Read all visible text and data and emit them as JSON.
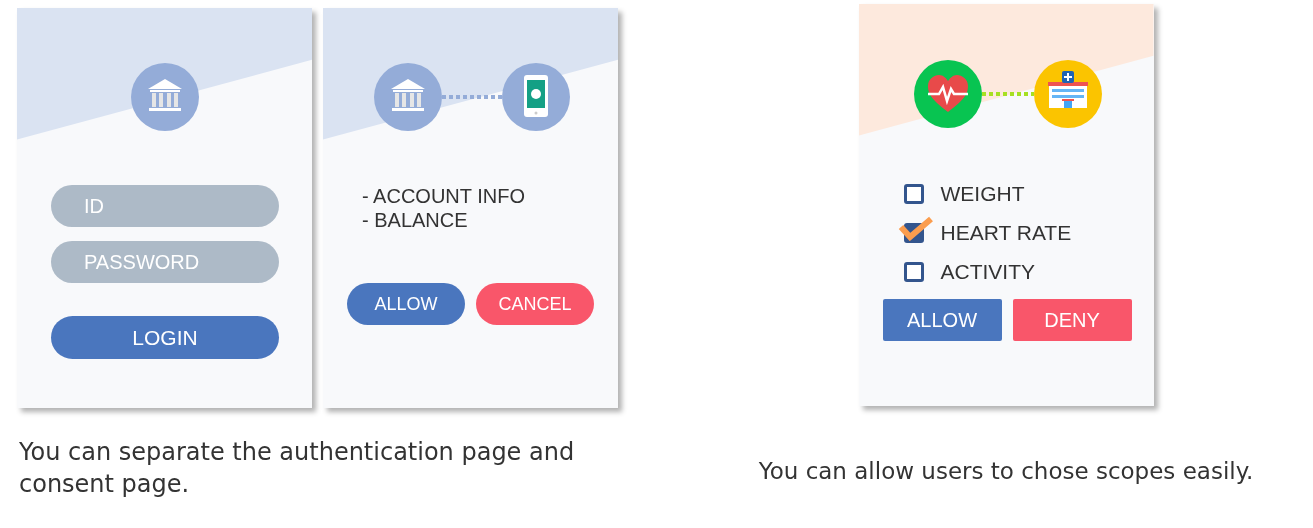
{
  "auth_page": {
    "fields": [
      {
        "placeholder": "ID"
      },
      {
        "placeholder": "PASSWORD"
      }
    ],
    "button": "LOGIN"
  },
  "consent_page": {
    "scopes": [
      "- ACCOUNT INFO",
      "- BALANCE"
    ],
    "buttons": [
      {
        "label": "ALLOW",
        "kind": "allow"
      },
      {
        "label": "CANCEL",
        "kind": "cancel"
      }
    ]
  },
  "caption_left": "You can separate the authentication page and consent page.",
  "scope_page": {
    "scopes": [
      {
        "label": "WEIGHT",
        "checked": false
      },
      {
        "label": "HEART RATE",
        "checked": true
      },
      {
        "label": "ACTIVITY",
        "checked": false
      }
    ],
    "buttons": [
      {
        "label": "ALLOW",
        "kind": "allow"
      },
      {
        "label": "DENY",
        "kind": "cancel"
      }
    ]
  },
  "caption_right": "You can allow users to chose scopes easily."
}
